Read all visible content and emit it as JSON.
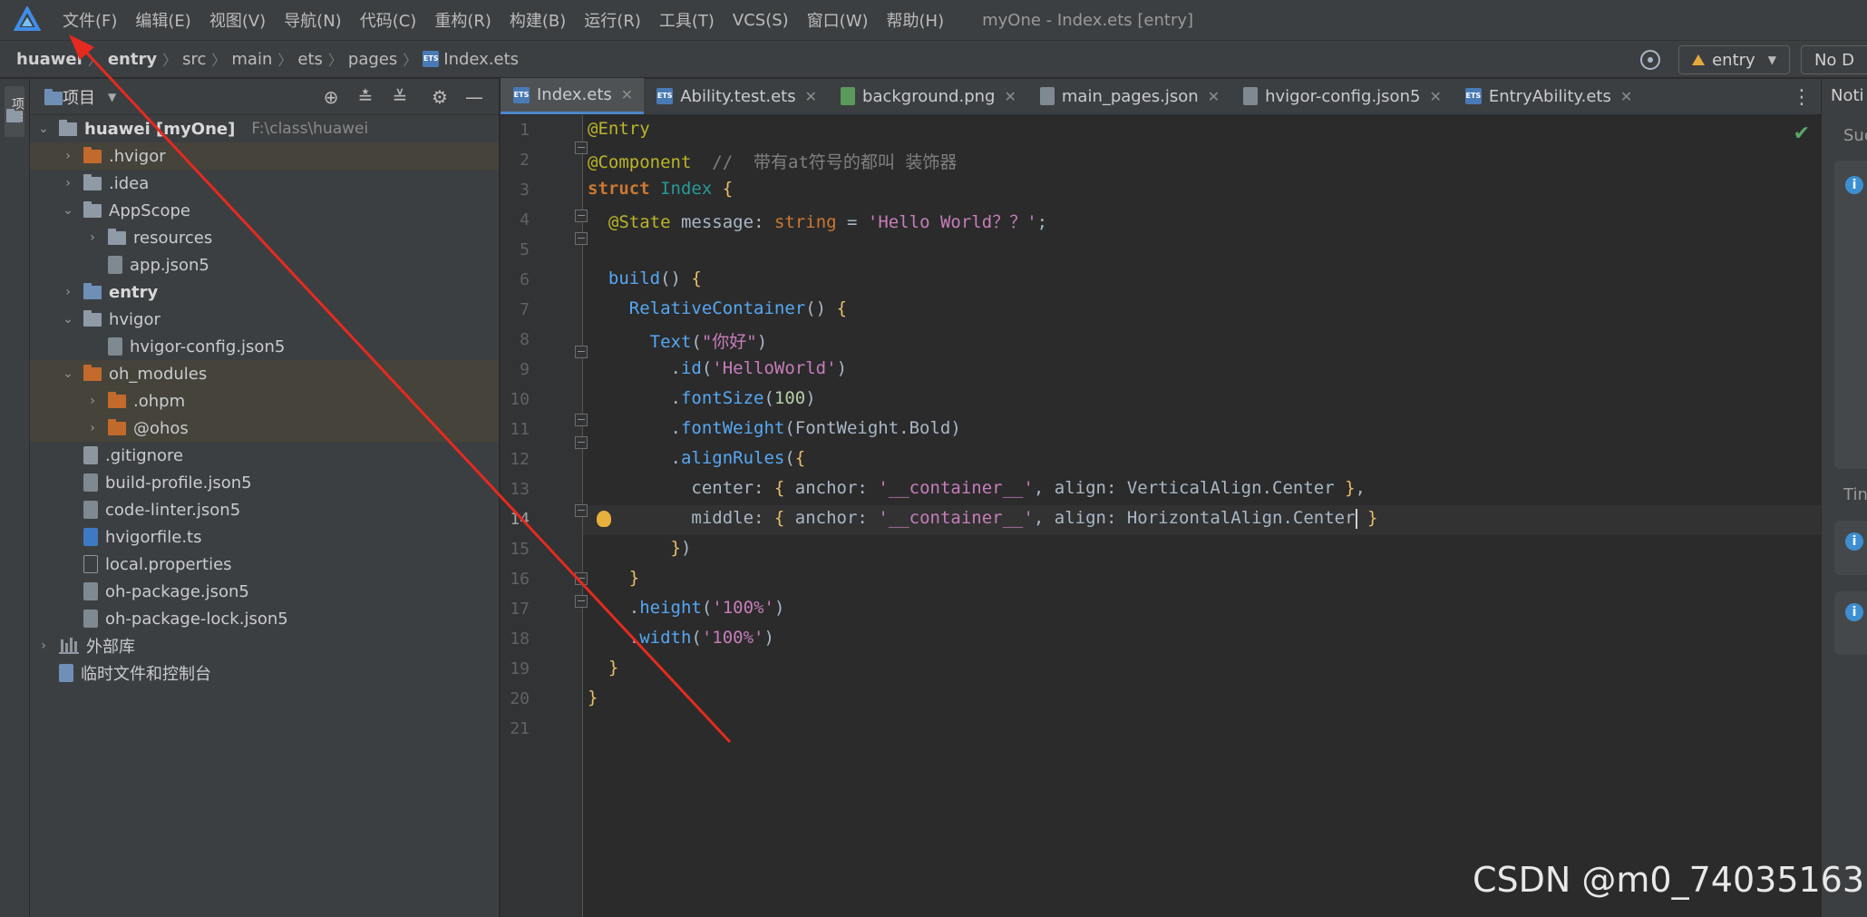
{
  "menubar": {
    "items": [
      "文件(F)",
      "编辑(E)",
      "视图(V)",
      "导航(N)",
      "代码(C)",
      "重构(R)",
      "构建(B)",
      "运行(R)",
      "工具(T)",
      "VCS(S)",
      "窗口(W)",
      "帮助(H)"
    ],
    "window_title": "myOne - Index.ets [entry]"
  },
  "breadcrumb": {
    "items": [
      "huawei",
      "entry",
      "src",
      "main",
      "ets",
      "pages",
      "Index.ets"
    ]
  },
  "toolbar": {
    "module_select": "entry",
    "device_select": "No D"
  },
  "toolstrip": {
    "project_tab": "项目"
  },
  "project": {
    "title": "项目",
    "rows": [
      {
        "label": "huawei [myOne]",
        "path": "F:\\class\\huawei"
      },
      {
        "label": ".hvigor"
      },
      {
        "label": ".idea"
      },
      {
        "label": "AppScope"
      },
      {
        "label": "resources"
      },
      {
        "label": "app.json5"
      },
      {
        "label": "entry"
      },
      {
        "label": "hvigor"
      },
      {
        "label": "hvigor-config.json5"
      },
      {
        "label": "oh_modules"
      },
      {
        "label": ".ohpm"
      },
      {
        "label": "@ohos"
      },
      {
        "label": ".gitignore"
      },
      {
        "label": "build-profile.json5"
      },
      {
        "label": "code-linter.json5"
      },
      {
        "label": "hvigorfile.ts"
      },
      {
        "label": "local.properties"
      },
      {
        "label": "oh-package.json5"
      },
      {
        "label": "oh-package-lock.json5"
      },
      {
        "label": "外部库"
      },
      {
        "label": "临时文件和控制台"
      }
    ]
  },
  "tabs": [
    "Index.ets",
    "Ability.test.ets",
    "background.png",
    "main_pages.json",
    "hvigor-config.json5",
    "EntryAbility.ets"
  ],
  "editor": {
    "line_numbers": [
      "1",
      "2",
      "3",
      "4",
      "5",
      "6",
      "7",
      "8",
      "9",
      "10",
      "11",
      "12",
      "13",
      "14",
      "15",
      "16",
      "17",
      "18",
      "19",
      "20",
      "21"
    ],
    "current_line": "14"
  },
  "notifications": {
    "title": "Noti",
    "sub1": "Suc",
    "sub2": "Tin"
  },
  "watermark": "CSDN @m0_74035163",
  "colors": {
    "accent": "#4a88c7",
    "annotation_arrow": "#e52a20",
    "highlight_row": "#45433a"
  }
}
